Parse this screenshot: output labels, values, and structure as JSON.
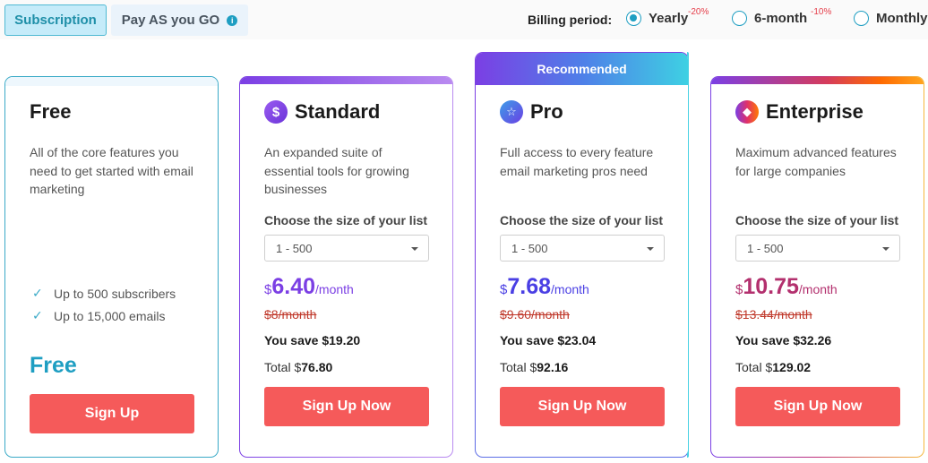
{
  "tabs": {
    "subscription": "Subscription",
    "payg": "Pay AS you GO",
    "payg_icon": "info-icon"
  },
  "billing": {
    "label": "Billing period:",
    "options": [
      {
        "label": "Yearly",
        "discount": "-20%",
        "selected": true
      },
      {
        "label": "6-month",
        "discount": "-10%",
        "selected": false
      },
      {
        "label": "Monthly",
        "discount": "",
        "selected": false
      }
    ]
  },
  "colors": {
    "accent": "#1e9ec2",
    "button": "#f55a5a",
    "standard": "#7b3fe4",
    "pro": "#4a3fe4",
    "enterprise": "#b3306e"
  },
  "plans": {
    "free": {
      "title": "Free",
      "description": "All of the core features you need to get started with email marketing",
      "features": [
        "Up to 500 subscribers",
        "Up to 15,000 emails"
      ],
      "price_label": "Free",
      "button": "Sign Up"
    },
    "standard": {
      "title": "Standard",
      "icon": "dollar-icon",
      "description": "An expanded suite of essential tools for growing businesses",
      "choose_label": "Choose the size of your list",
      "list_size": "1 - 500",
      "currency": "$",
      "price": "6.40",
      "per": "/month",
      "old_price": "$8/month",
      "save": "You save $19.20",
      "total_label": "Total $",
      "total_value": "76.80",
      "button": "Sign Up Now"
    },
    "pro": {
      "badge": "Recommended",
      "title": "Pro",
      "icon": "star-icon",
      "description": "Full access to every feature email marketing pros need",
      "choose_label": "Choose the size of your list",
      "list_size": "1 - 500",
      "currency": "$",
      "price": "7.68",
      "per": "/month",
      "old_price": "$9.60/month",
      "save": "You save $23.04",
      "total_label": "Total $",
      "total_value": "92.16",
      "button": "Sign Up Now"
    },
    "enterprise": {
      "title": "Enterprise",
      "icon": "diamond-icon",
      "description": "Maximum advanced features for large companies",
      "choose_label": "Choose the size of your list",
      "list_size": "1 - 500",
      "currency": "$",
      "price": "10.75",
      "per": "/month",
      "old_price": "$13.44/month",
      "save": "You save $32.26",
      "total_label": "Total $",
      "total_value": "129.02",
      "button": "Sign Up Now"
    }
  }
}
